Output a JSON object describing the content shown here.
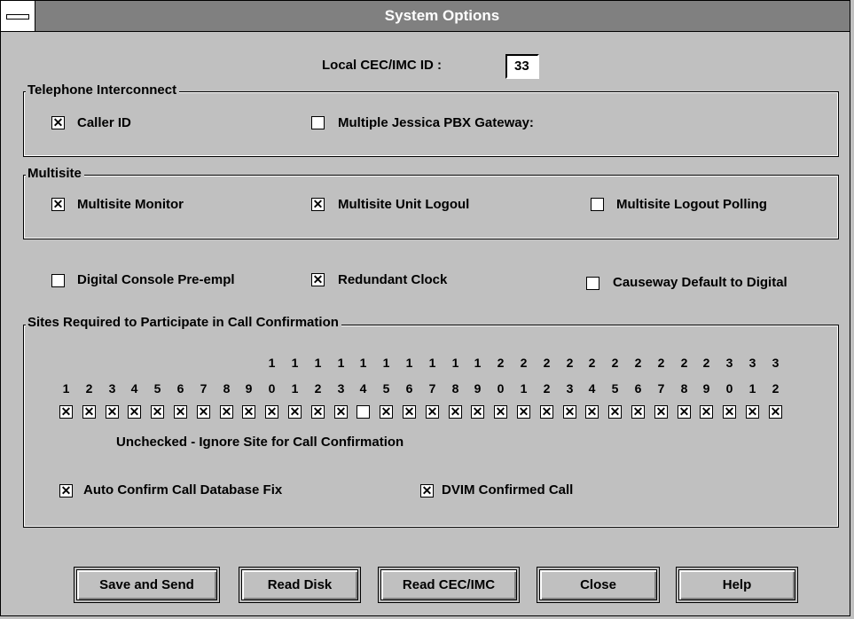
{
  "window": {
    "title": "System Options"
  },
  "local_id": {
    "label": "Local CEC/IMC ID :",
    "value": "33"
  },
  "telephone_interconnect": {
    "title": "Telephone Interconnect",
    "caller_id": {
      "label": "Caller ID",
      "checked": true
    },
    "multiple_pbx": {
      "label": "Multiple Jessica PBX Gateway:",
      "checked": false
    }
  },
  "multisite": {
    "title": "Multisite",
    "monitor": {
      "label": "Multisite Monitor",
      "checked": true
    },
    "unit_logout": {
      "label": "Multisite Unit Logoul",
      "checked": true
    },
    "logout_polling": {
      "label": "Multisite Logout Polling",
      "checked": false
    }
  },
  "misc": {
    "digital_console": {
      "label": "Digital Console Pre-empl",
      "checked": false
    },
    "redundant_clock": {
      "label": "Redundant Clock",
      "checked": true
    },
    "causeway": {
      "label": "Causeway Default to Digital",
      "checked": false
    }
  },
  "call_confirmation": {
    "title": "Sites Required to Participate in Call Confirmation",
    "tens_row": [
      "",
      "",
      "",
      "",
      "",
      "",
      "",
      "",
      "",
      "1",
      "1",
      "1",
      "1",
      "1",
      "1",
      "1",
      "1",
      "1",
      "1",
      "2",
      "2",
      "2",
      "2",
      "2",
      "2",
      "2",
      "2",
      "2",
      "2",
      "3",
      "3",
      "3"
    ],
    "ones_row": [
      "1",
      "2",
      "3",
      "4",
      "5",
      "6",
      "7",
      "8",
      "9",
      "0",
      "1",
      "2",
      "3",
      "4",
      "5",
      "6",
      "7",
      "8",
      "9",
      "0",
      "1",
      "2",
      "3",
      "4",
      "5",
      "6",
      "7",
      "8",
      "9",
      "0",
      "1",
      "2"
    ],
    "sites_checked": [
      true,
      true,
      true,
      true,
      true,
      true,
      true,
      true,
      true,
      true,
      true,
      true,
      true,
      false,
      true,
      true,
      true,
      true,
      true,
      true,
      true,
      true,
      true,
      true,
      true,
      true,
      true,
      true,
      true,
      true,
      true,
      true
    ],
    "note": "Unchecked - Ignore Site for Call Confirmation",
    "auto_confirm": {
      "label": "Auto Confirm Call Database Fix",
      "checked": true
    },
    "dvim_confirmed": {
      "label": "DVIM Confirmed Call",
      "checked": true
    }
  },
  "buttons": {
    "save_send": "Save and Send",
    "read_disk": "Read Disk",
    "read_cec": "Read CEC/IMC",
    "close": "Close",
    "help": "Help"
  }
}
